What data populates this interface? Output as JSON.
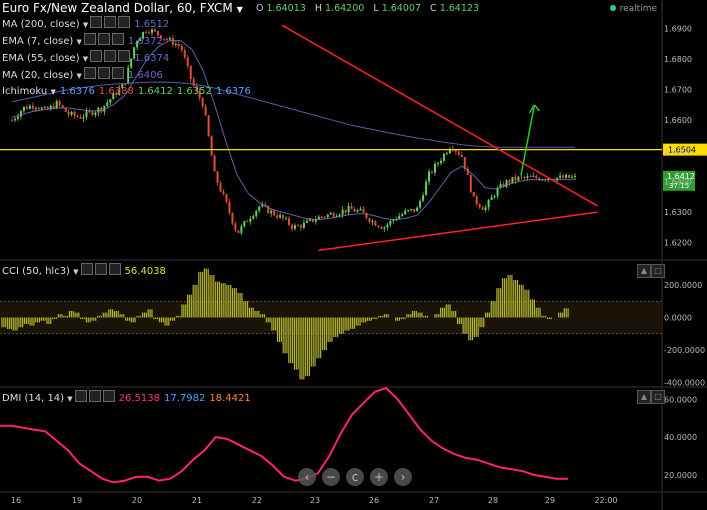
{
  "header": {
    "symbol_title": "Euro Fx/New Zealand Dollar, 60, FXCM",
    "ohlc": [
      {
        "label": "O",
        "value": "1.64013"
      },
      {
        "label": "H",
        "value": "1.64200"
      },
      {
        "label": "L",
        "value": "1.64007"
      },
      {
        "label": "C",
        "value": "1.64123"
      }
    ],
    "realtime": "realtime"
  },
  "indicators": [
    {
      "name": "MA (200, close)",
      "value": "1.6512"
    },
    {
      "name": "EMA (7, close)",
      "value": "1.6372"
    },
    {
      "name": "EMA (55, close)",
      "value": "1.6374"
    },
    {
      "name": "MA (20, close)",
      "value": "1.6406"
    }
  ],
  "ichimoku": {
    "name": "Ichimoku",
    "values": [
      "1.6376",
      "1.6388",
      "1.6412",
      "1.6352",
      "1.6376"
    ]
  },
  "cci_legend": {
    "name": "CCI (50, hlc3)",
    "value": "56.4038"
  },
  "dmi_legend": {
    "name": "DMI (14, 14)",
    "values": [
      "26.5138",
      "17.7982",
      "18.4421"
    ]
  },
  "price_tags": {
    "support_level": "1.6504",
    "last_price": "1.6412",
    "countdown": "37:15"
  },
  "nav": [
    "‹",
    "−",
    "c",
    "+",
    "›"
  ],
  "colors": {
    "trendline": "#ff2222",
    "level": "#ffdd00",
    "arrow": "#22cc22",
    "up": "#5fd35f",
    "down": "#e05030",
    "cci": "#b5b530",
    "dmi": "#ff2277",
    "ma": "#5a5aa8"
  },
  "chart_data": [
    {
      "type": "line",
      "title": "Euro Fx/New Zealand Dollar, 60, FXCM",
      "x_ticks": [
        "16",
        "19",
        "20",
        "21",
        "22",
        "23",
        "26",
        "27",
        "28",
        "29",
        "22:00"
      ],
      "y_ticks": [
        "1.6900",
        "1.6800",
        "1.6700",
        "1.6600",
        "1.6500",
        "1.6400",
        "1.6300",
        "1.6200"
      ],
      "ylim": [
        1.615,
        1.696
      ],
      "close_path_x": [
        0,
        0.5,
        1,
        1.5,
        2,
        2.5,
        3,
        3.5,
        4,
        4.5,
        5,
        5.5,
        6,
        6.5,
        7,
        7.5,
        8,
        8.5,
        9,
        9.5,
        10,
        10.5,
        11,
        11.5,
        12,
        12.5,
        13,
        13.5,
        14,
        14.5,
        15,
        15.5,
        16,
        16.5,
        17,
        17.5,
        18,
        18.5,
        19,
        19.5,
        20,
        20.5,
        21,
        21.5,
        22,
        22.5,
        23,
        23.5,
        24,
        24.5,
        25
      ],
      "close_path_y": [
        1.66,
        1.664,
        1.665,
        1.663,
        1.6655,
        1.662,
        1.661,
        1.6625,
        1.664,
        1.668,
        1.672,
        1.686,
        1.69,
        1.688,
        1.686,
        1.684,
        1.672,
        1.665,
        1.642,
        1.633,
        1.623,
        1.628,
        1.632,
        1.63,
        1.628,
        1.625,
        1.626,
        1.628,
        1.629,
        1.63,
        1.631,
        1.63,
        1.627,
        1.625,
        1.628,
        1.63,
        1.631,
        1.642,
        1.647,
        1.652,
        1.648,
        1.634,
        1.631,
        1.637,
        1.64,
        1.641,
        1.6412,
        1.6412,
        1.6412,
        1.6412,
        1.6412
      ],
      "ma200": [
        1.666,
        1.6668,
        1.6676,
        1.6684,
        1.6692,
        1.67,
        1.6705,
        1.671,
        1.6715,
        1.6718,
        1.672,
        1.6722,
        1.6724,
        1.6725,
        1.6724,
        1.6722,
        1.6718,
        1.6712,
        1.6705,
        1.6695,
        1.6685,
        1.6675,
        1.6665,
        1.6655,
        1.6645,
        1.6635,
        1.6625,
        1.6615,
        1.6605,
        1.6595,
        1.6585,
        1.6577,
        1.657,
        1.6562,
        1.6555,
        1.6548,
        1.6542,
        1.6536,
        1.653,
        1.6525,
        1.652,
        1.6516,
        1.6514,
        1.6512,
        1.6512,
        1.6512,
        1.6512,
        1.6512,
        1.6512,
        1.6512,
        1.6512
      ],
      "ma20": [
        1.661,
        1.662,
        1.663,
        1.6635,
        1.664,
        1.664,
        1.6635,
        1.663,
        1.6632,
        1.665,
        1.668,
        1.674,
        1.68,
        1.684,
        1.686,
        1.686,
        1.683,
        1.676,
        1.665,
        1.653,
        1.642,
        1.636,
        1.633,
        1.631,
        1.63,
        1.629,
        1.628,
        1.6275,
        1.6278,
        1.6285,
        1.6292,
        1.6295,
        1.629,
        1.628,
        1.6275,
        1.628,
        1.629,
        1.633,
        1.638,
        1.643,
        1.645,
        1.642,
        1.638,
        1.6375,
        1.639,
        1.64,
        1.6406,
        1.6406,
        1.6406,
        1.6406,
        1.6406
      ],
      "resistance_line": {
        "from": [
          12.0,
          1.691
        ],
        "to": [
          26.0,
          1.632
        ]
      },
      "support_line": {
        "from": [
          13.6,
          1.6175
        ],
        "to": [
          26.0,
          1.63
        ]
      },
      "level": 1.6504,
      "arrow": {
        "from": [
          22.6,
          1.642
        ],
        "to": [
          23.2,
          1.665
        ]
      }
    },
    {
      "type": "bar",
      "title": "CCI (50, hlc3)",
      "y_ticks": [
        "200.0000",
        "0.0000",
        "-200.0000",
        "-400.0000"
      ],
      "ylim": [
        -420,
        340
      ],
      "band": [
        -100,
        100
      ],
      "x": [
        0,
        1,
        2,
        3,
        4,
        5,
        6,
        7,
        8,
        9,
        10,
        11,
        12,
        13,
        14,
        15,
        16,
        17,
        18,
        19,
        20,
        21,
        22,
        23,
        24,
        25,
        26,
        27,
        28,
        29,
        30,
        31,
        32,
        33,
        34,
        35,
        36,
        37,
        38,
        39,
        40,
        41,
        42,
        43,
        44,
        45,
        46,
        47,
        48,
        49,
        50,
        51,
        52,
        53,
        54,
        55,
        56,
        57,
        58,
        59,
        60,
        61,
        62,
        63,
        64,
        65,
        66,
        67,
        68,
        69,
        70,
        71,
        72,
        73,
        74,
        75,
        76,
        77,
        78,
        79,
        80,
        81,
        82,
        83,
        84,
        85,
        86,
        87,
        88,
        89,
        90,
        91,
        92,
        93,
        94,
        95,
        96,
        97,
        98,
        99,
        100
      ],
      "values": [
        -60,
        -70,
        -80,
        -60,
        -40,
        -50,
        -30,
        -20,
        -40,
        -10,
        20,
        10,
        40,
        30,
        -10,
        -30,
        -20,
        10,
        30,
        50,
        40,
        20,
        -20,
        -30,
        10,
        30,
        50,
        -10,
        -30,
        -50,
        -20,
        10,
        80,
        140,
        200,
        280,
        300,
        260,
        220,
        210,
        200,
        180,
        150,
        100,
        60,
        40,
        20,
        -30,
        -80,
        -150,
        -220,
        -280,
        -320,
        -380,
        -360,
        -300,
        -250,
        -200,
        -150,
        -120,
        -100,
        -80,
        -70,
        -50,
        -30,
        -20,
        -10,
        10,
        20,
        0,
        -20,
        -10,
        20,
        40,
        30,
        10,
        0,
        20,
        60,
        80,
        40,
        -40,
        -100,
        -140,
        -120,
        -60,
        30,
        100,
        180,
        240,
        260,
        230,
        200,
        170,
        110,
        60,
        10,
        -10,
        0,
        30,
        56
      ]
    },
    {
      "type": "line",
      "title": "DMI (14, 14)",
      "y_ticks": [
        "60.0000",
        "40.0000",
        "20.0000"
      ],
      "ylim": [
        12,
        66
      ],
      "x": [
        0,
        1,
        2,
        3,
        4,
        5,
        6,
        7,
        8,
        9,
        10,
        11,
        12,
        13,
        14,
        15,
        16,
        17,
        18,
        19,
        20,
        21,
        22,
        23,
        24,
        25,
        26,
        27,
        28,
        29,
        30,
        31,
        32,
        33,
        34,
        35,
        36,
        37,
        38,
        39,
        40,
        41,
        42,
        43,
        44,
        45,
        46,
        47,
        48,
        49,
        50
      ],
      "values": [
        46,
        46,
        45,
        44,
        43,
        38,
        33,
        26,
        22,
        18,
        16,
        17,
        19,
        19,
        17,
        18,
        22,
        28,
        33,
        40,
        39,
        36,
        33,
        30,
        25,
        19,
        17,
        18,
        21,
        30,
        42,
        52,
        58,
        64,
        66,
        60,
        52,
        44,
        38,
        34,
        31,
        29,
        28,
        26,
        24,
        23,
        22,
        20,
        19,
        18,
        18
      ]
    }
  ]
}
